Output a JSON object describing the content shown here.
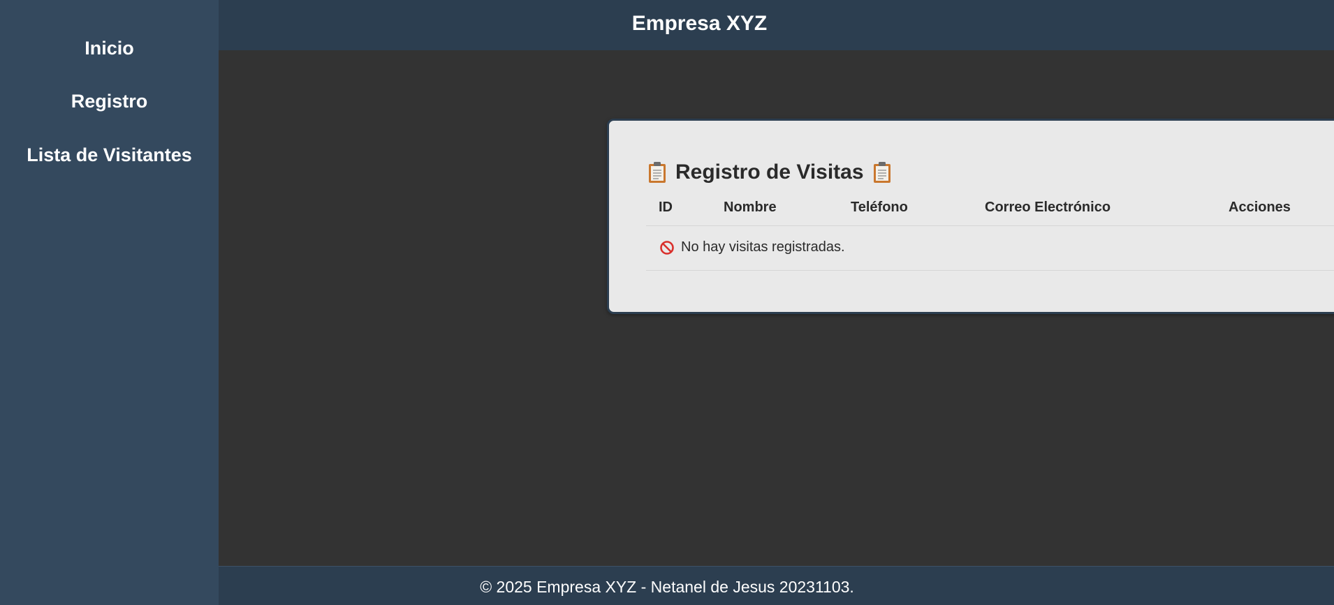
{
  "header": {
    "title": "Empresa XYZ"
  },
  "sidebar": {
    "items": [
      {
        "label": "Inicio"
      },
      {
        "label": "Registro"
      },
      {
        "label": "Lista de Visitantes"
      }
    ]
  },
  "main": {
    "title": "Registro de Visitas",
    "title_icon": "clipboard-icon",
    "table": {
      "columns": [
        "ID",
        "Nombre",
        "Teléfono",
        "Correo Electrónico",
        "Acciones"
      ],
      "rows": [],
      "empty_icon": "prohibited-icon",
      "empty_message": "No hay visitas registradas."
    }
  },
  "footer": {
    "text": "© 2025 Empresa XYZ - Netanel de Jesus 20231103."
  },
  "colors": {
    "sidebar": "#34495e",
    "header": "#2c3e50",
    "background": "#333333",
    "card": "#e9e9e9",
    "empty_icon": "#d9302c"
  }
}
